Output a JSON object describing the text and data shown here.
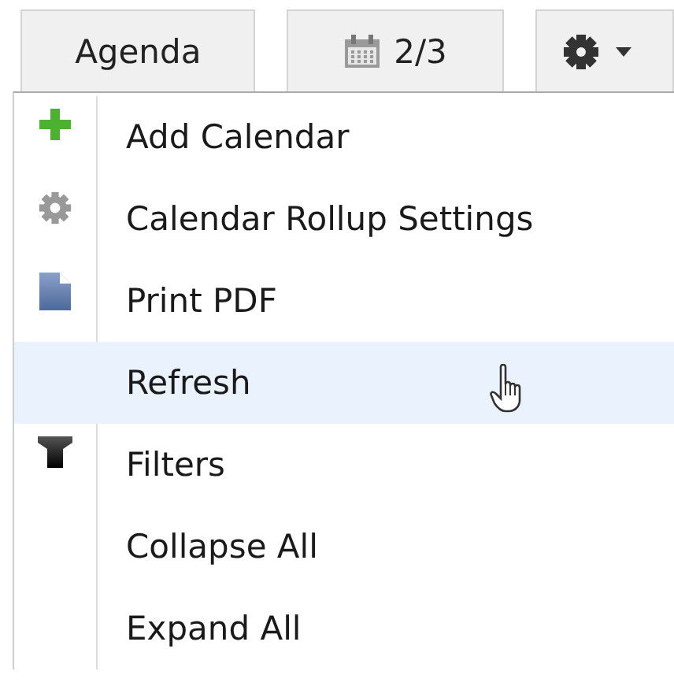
{
  "toolbar": {
    "buttons": [
      {
        "kind": "text",
        "label": "Agenda"
      },
      {
        "kind": "calendar",
        "label": "2/3"
      },
      {
        "kind": "settings"
      }
    ]
  },
  "menu": {
    "items": [
      {
        "label": "Add Calendar",
        "kind": "plus",
        "selected": false
      },
      {
        "label": "Calendar Rollup Settings",
        "kind": "gear",
        "selected": false
      },
      {
        "label": "Print PDF",
        "kind": "document",
        "selected": false
      },
      {
        "label": "Refresh",
        "kind": "plain",
        "selected": true
      },
      {
        "label": "Filters",
        "kind": "filter",
        "selected": false
      },
      {
        "label": "Collapse All",
        "kind": "plain",
        "selected": false
      },
      {
        "label": "Expand All",
        "kind": "plain",
        "selected": false
      }
    ]
  }
}
